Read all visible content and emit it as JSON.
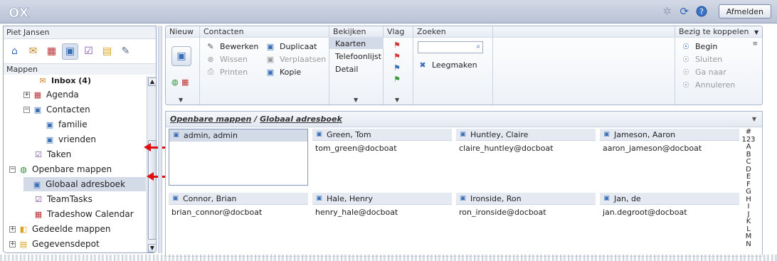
{
  "app": {
    "logo_text": "OX",
    "logout_label": "Afmelden"
  },
  "colors": {
    "accent": "#d4dbe8",
    "arrow": "#e01010"
  },
  "sidebar": {
    "user": "Piet Jansen",
    "section_title": "Mappen",
    "tree": [
      {
        "label": "Inbox (4)"
      },
      {
        "label": "Agenda"
      },
      {
        "label": "Contacten"
      },
      {
        "label": "familie"
      },
      {
        "label": "vrienden"
      },
      {
        "label": "Taken"
      },
      {
        "label": "Openbare mappen"
      },
      {
        "label": "Globaal adresboek"
      },
      {
        "label": "TeamTasks"
      },
      {
        "label": "Tradeshow Calendar"
      },
      {
        "label": "Gedeelde mappen"
      },
      {
        "label": "Gegevensdepot"
      }
    ]
  },
  "toolbar": {
    "nieuw": {
      "title": "Nieuw"
    },
    "contacten": {
      "title": "Contacten",
      "bewerken": "Bewerken",
      "wissen": "Wissen",
      "printen": "Printen",
      "duplicaat": "Duplicaat",
      "verplaatsen": "Verplaatsen",
      "kopie": "Kopie"
    },
    "bekijken": {
      "title": "Bekijken",
      "kaarten": "Kaarten",
      "telefoonlijst": "Telefoonlijst",
      "detail": "Detail"
    },
    "vlag": {
      "title": "Vlag"
    },
    "zoeken": {
      "title": "Zoeken",
      "placeholder": "",
      "clear": "Leegmaken"
    },
    "koppelen": {
      "title": "Bezig te koppelen",
      "begin": "Begin",
      "sluiten": "Sluiten",
      "ganaar": "Ga naar",
      "annuleren": "Annuleren"
    }
  },
  "content": {
    "breadcrumb_parent": "Openbare mappen",
    "breadcrumb_sep": " / ",
    "breadcrumb_current": "Globaal adresboek",
    "contacts": [
      {
        "name": "admin, admin",
        "email": ""
      },
      {
        "name": "Green, Tom",
        "email": "tom_green@docboat"
      },
      {
        "name": "Huntley, Claire",
        "email": "claire_huntley@docboat"
      },
      {
        "name": "Jameson, Aaron",
        "email": "aaron_jameson@docboat"
      },
      {
        "name": "Connor, Brian",
        "email": "brian_connor@docboat"
      },
      {
        "name": "Hale, Henry",
        "email": "henry_hale@docboat"
      },
      {
        "name": "Ironside, Ron",
        "email": "ron_ironside@docboat"
      },
      {
        "name": "Jan, de",
        "email": "jan.degroot@docboat"
      }
    ],
    "alphabet": [
      "#",
      "123",
      "A",
      "B",
      "C",
      "D",
      "E",
      "F",
      "G",
      "H",
      "I",
      "J",
      "K",
      "L",
      "M",
      "N"
    ]
  }
}
